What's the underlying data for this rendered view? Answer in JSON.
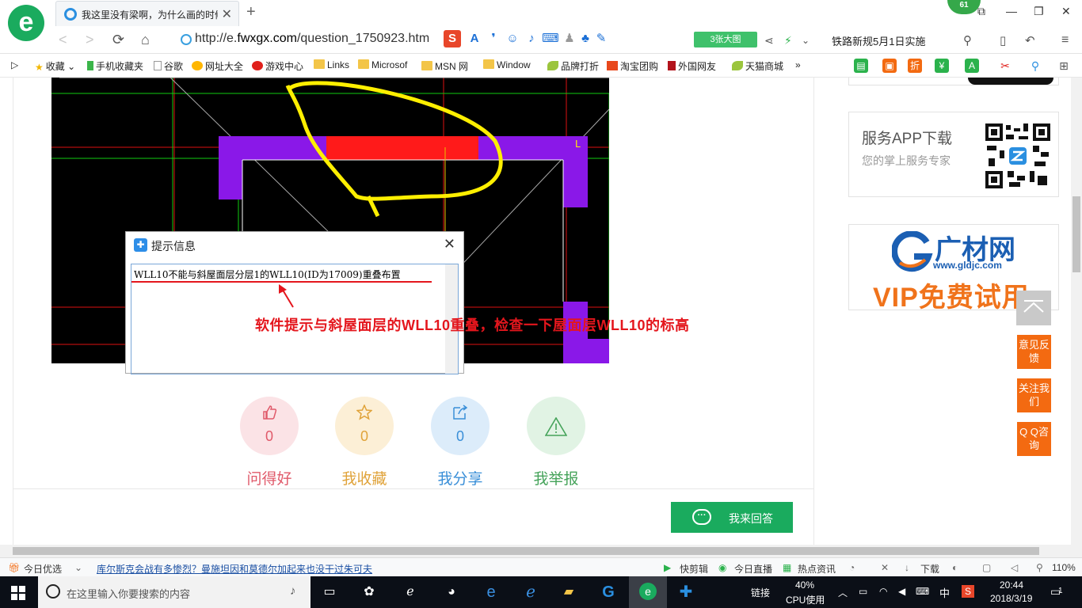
{
  "browser": {
    "tab_title": "我这里没有梁啊，为什么画的时候…",
    "level_badge": "61",
    "url_prefix": "http://e.",
    "url_domain": "fwxgx.com",
    "url_path": "/question_1750923.htm",
    "big_image_btn": "3张大图",
    "news_ticker": "铁路新规5月1日实施"
  },
  "favorites": [
    "收藏",
    "手机收藏夹",
    "谷歌",
    "网址大全",
    "游戏中心",
    "Links",
    "Microsof",
    "MSN 网",
    "Window",
    "品牌打折",
    "淘宝团购",
    "外国网友",
    "天猫商城"
  ],
  "dialog": {
    "title": "提示信息",
    "message": "WLL10不能与斜屋面层分层1的WLL10(ID为17009)重叠布置"
  },
  "annotation": "软件提示与斜屋面层的WLL10重叠，检查一下屋面层WLL10的标高",
  "actions": [
    {
      "label": "问得好",
      "count": "0",
      "color": "#e05a6a",
      "bg": "#fbe3e6",
      "icon": "thumbs-up-icon"
    },
    {
      "label": "我收藏",
      "count": "0",
      "color": "#e0a33a",
      "bg": "#fcefd6",
      "icon": "star-icon"
    },
    {
      "label": "我分享",
      "count": "0",
      "color": "#3a8fd8",
      "bg": "#dcecfa",
      "icon": "share-icon"
    },
    {
      "label": "我举报",
      "count": "",
      "color": "#45a35a",
      "bg": "#e1f3e4",
      "icon": "warning-icon"
    }
  ],
  "answer_button": "我来回答",
  "sidebar": {
    "app_title": "服务APP下载",
    "app_desc": "您的掌上服务专家",
    "brand_name": "广材网",
    "brand_url": "www.gldjc.com",
    "brand_promo": "VIP免费试用",
    "feedback": "意见反馈",
    "follow": "关注我们",
    "qq": "Q Q咨询"
  },
  "statusbar": {
    "today_pick": "今日优选",
    "headline": "库尔斯克会战有多惨烈？曼施坦因和莫德尔加起来也没干过朱可夫",
    "quick_clip": "快剪辑",
    "live": "今日直播",
    "hot_news": "热点资讯",
    "download": "下载",
    "zoom": "110%"
  },
  "taskbar": {
    "search_placeholder": "在这里输入你要搜索的内容",
    "link_label": "链接",
    "cpu_percent": "40%",
    "cpu_label": "CPU使用",
    "ime": "中",
    "time": "20:44",
    "date": "2018/3/19",
    "notifications": "1"
  }
}
